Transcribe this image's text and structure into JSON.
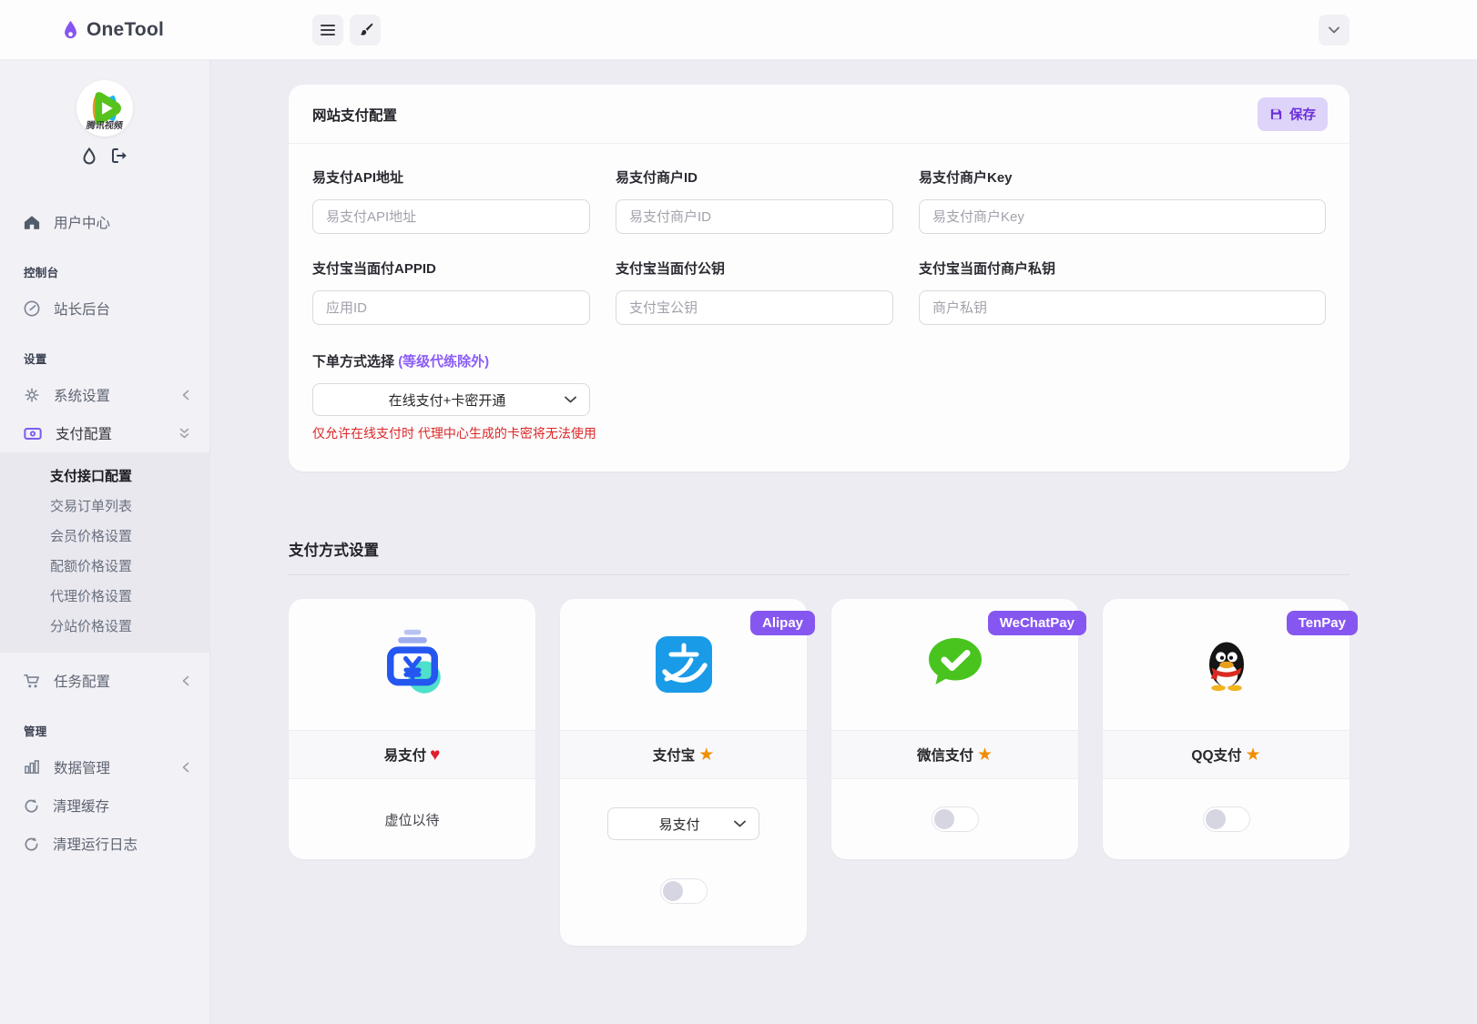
{
  "header": {
    "brand": "OneTool"
  },
  "sidebar": {
    "user_center": "用户中心",
    "caption_console": "控制台",
    "webmaster": "站长后台",
    "caption_settings": "设置",
    "system_settings": "系统设置",
    "payment_config": "支付配置",
    "submenu": [
      "支付接口配置",
      "交易订单列表",
      "会员价格设置",
      "配额价格设置",
      "代理价格设置",
      "分站价格设置"
    ],
    "task_config": "任务配置",
    "caption_manage": "管理",
    "data_manage": "数据管理",
    "clear_cache": "清理缓存",
    "clear_logs": "清理运行日志",
    "avatar_caption": "腾讯视频"
  },
  "payment_config": {
    "title": "网站支付配置",
    "save_label": "保存",
    "fields": [
      {
        "label": "易支付API地址",
        "placeholder": "易支付API地址",
        "value": ""
      },
      {
        "label": "易支付商户ID",
        "placeholder": "易支付商户ID",
        "value": ""
      },
      {
        "label": "易支付商户Key",
        "placeholder": "易支付商户Key",
        "value": ""
      },
      {
        "label": "支付宝当面付APPID",
        "placeholder": "应用ID",
        "value": ""
      },
      {
        "label": "支付宝当面付公钥",
        "placeholder": "支付宝公钥",
        "value": ""
      },
      {
        "label": "支付宝当面付商户私钥",
        "placeholder": "商户私钥",
        "value": ""
      }
    ],
    "order_mode": {
      "label": "下单方式选择",
      "note": "(等级代练除外)",
      "selected": "在线支付+卡密开通",
      "warning": "仅允许在线支付时 代理中心生成的卡密将无法使用"
    }
  },
  "payment_methods": {
    "title": "支付方式设置",
    "cards": [
      {
        "name": "易支付",
        "suffix": "♥",
        "body": "虚位以待"
      },
      {
        "name": "支付宝",
        "suffix": "★",
        "badge": "Alipay",
        "select": "易支付",
        "enabled": false
      },
      {
        "name": "微信支付",
        "suffix": "★",
        "badge": "WeChatPay",
        "enabled": false
      },
      {
        "name": "QQ支付",
        "suffix": "★",
        "badge": "TenPay",
        "enabled": false
      }
    ]
  },
  "colors": {
    "accent_purple": "#8657f0",
    "save_bg": "#ded4fa",
    "warning_red": "#dc2626",
    "alipay_blue": "#1a9be8",
    "wechat_green": "#49c41f",
    "easypay_blue": "#2456f0",
    "easypay_teal": "#4fe0cb"
  }
}
